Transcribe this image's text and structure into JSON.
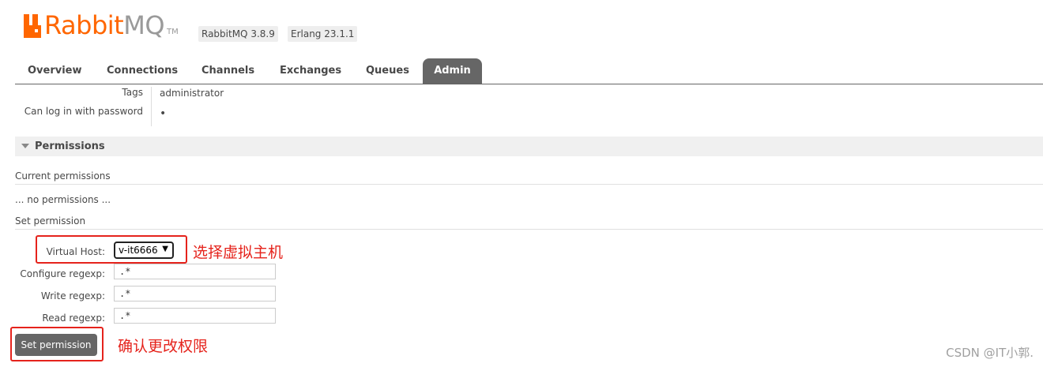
{
  "logo": {
    "rabbit": "Rabbit",
    "mq": "MQ",
    "tm": "TM"
  },
  "badges": {
    "version": "RabbitMQ 3.8.9",
    "erlang": "Erlang 23.1.1"
  },
  "tabs": [
    {
      "label": "Overview"
    },
    {
      "label": "Connections"
    },
    {
      "label": "Channels"
    },
    {
      "label": "Exchanges"
    },
    {
      "label": "Queues"
    },
    {
      "label": "Admin",
      "active": true
    }
  ],
  "user": {
    "tags_label": "Tags",
    "tags_value": "administrator",
    "login_label": "Can log in with password",
    "login_value": "•"
  },
  "permissions": {
    "title": "Permissions",
    "current_heading": "Current permissions",
    "no_permissions": "... no permissions ...",
    "set_heading": "Set permission",
    "vhost_label": "Virtual Host:",
    "vhost_selected": "v-it6666",
    "configure_label": "Configure regexp:",
    "configure_value": ".*",
    "write_label": "Write regexp:",
    "write_value": ".*",
    "read_label": "Read regexp:",
    "read_value": ".*",
    "submit_label": "Set permission"
  },
  "annotations": {
    "select_vhost": "选择虚拟主机",
    "confirm": "确认更改权限",
    "color": "#e5231c"
  },
  "watermark": "CSDN @IT小郭."
}
